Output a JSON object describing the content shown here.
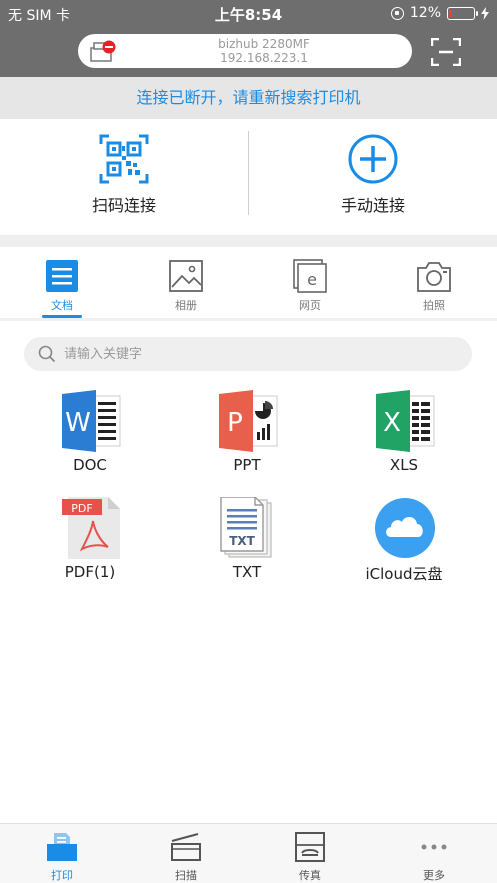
{
  "status_bar": {
    "carrier": "无 SIM 卡",
    "time": "上午8:54",
    "battery": "12%",
    "battery_level": 0.12
  },
  "printer": {
    "model": "bizhub 2280MF",
    "ip": "192.168.223.1"
  },
  "banner": {
    "disconnect_text": "连接已断开，请重新搜索打印机"
  },
  "connect": {
    "scan_label": "扫码连接",
    "manual_label": "手动连接"
  },
  "tabs": [
    {
      "label": "文档",
      "active": true
    },
    {
      "label": "相册",
      "active": false
    },
    {
      "label": "网页",
      "active": false
    },
    {
      "label": "拍照",
      "active": false
    }
  ],
  "search": {
    "placeholder": "请输入关键字"
  },
  "files": [
    {
      "label": "DOC",
      "icon": "word-icon",
      "letter": "W"
    },
    {
      "label": "PPT",
      "icon": "powerpoint-icon",
      "letter": "P"
    },
    {
      "label": "XLS",
      "icon": "excel-icon",
      "letter": "X"
    },
    {
      "label": "PDF(1)",
      "icon": "pdf-icon",
      "tag": "PDF"
    },
    {
      "label": "TXT",
      "icon": "txt-icon",
      "tag": "TXT"
    },
    {
      "label": "iCloud云盘",
      "icon": "icloud-icon"
    }
  ],
  "bottom_nav": [
    {
      "label": "打印",
      "active": true
    },
    {
      "label": "扫描",
      "active": false
    },
    {
      "label": "传真",
      "active": false
    },
    {
      "label": "更多",
      "active": false
    }
  ],
  "colors": {
    "accent": "#1a8ce6",
    "header": "#6e6e6e",
    "word": "#2b7cd3",
    "ppt": "#e8604c",
    "excel": "#21a366",
    "pdf": "#e8504a",
    "icloud": "#3ba0f0"
  }
}
